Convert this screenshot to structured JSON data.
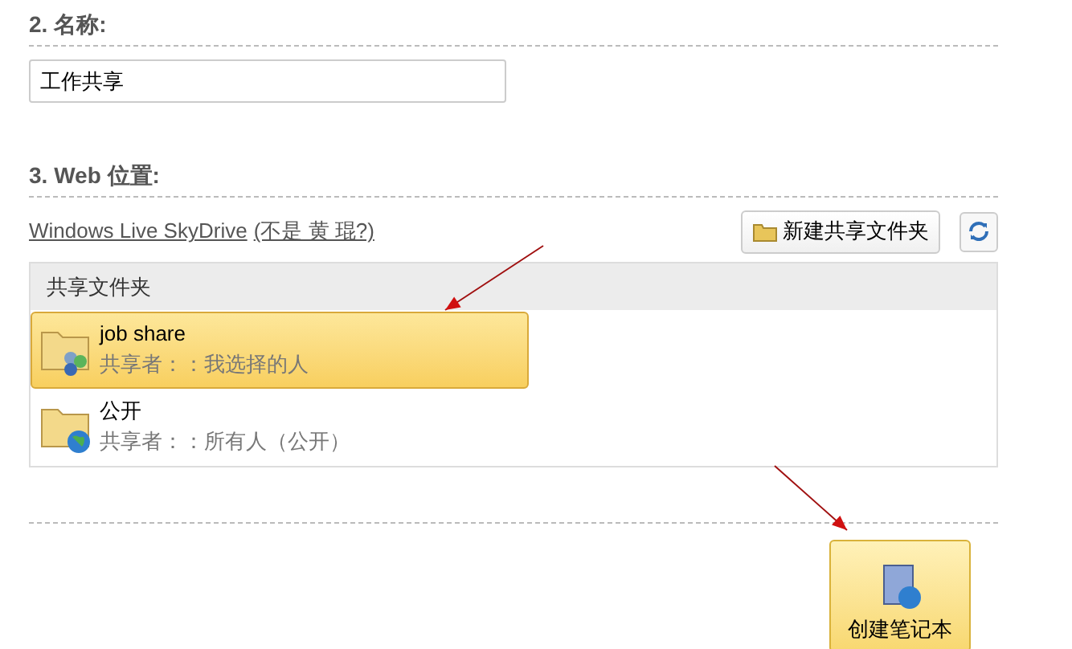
{
  "name_section": {
    "heading": "2. 名称:",
    "value": "工作共享"
  },
  "web_section": {
    "heading": "3. Web 位置:",
    "service_link": "Windows Live SkyDrive",
    "account_link": "(不是 黄 琨?)",
    "new_folder_button": "新建共享文件夹"
  },
  "folder_list": {
    "header": "共享文件夹",
    "items": [
      {
        "kind": "people",
        "name": "job share",
        "shared_with": "共享者：：我选择的人",
        "selected": true
      },
      {
        "kind": "public",
        "name": "公开",
        "shared_with": "共享者：：所有人（公开）",
        "selected": false
      }
    ]
  },
  "create_button": "创建笔记本"
}
